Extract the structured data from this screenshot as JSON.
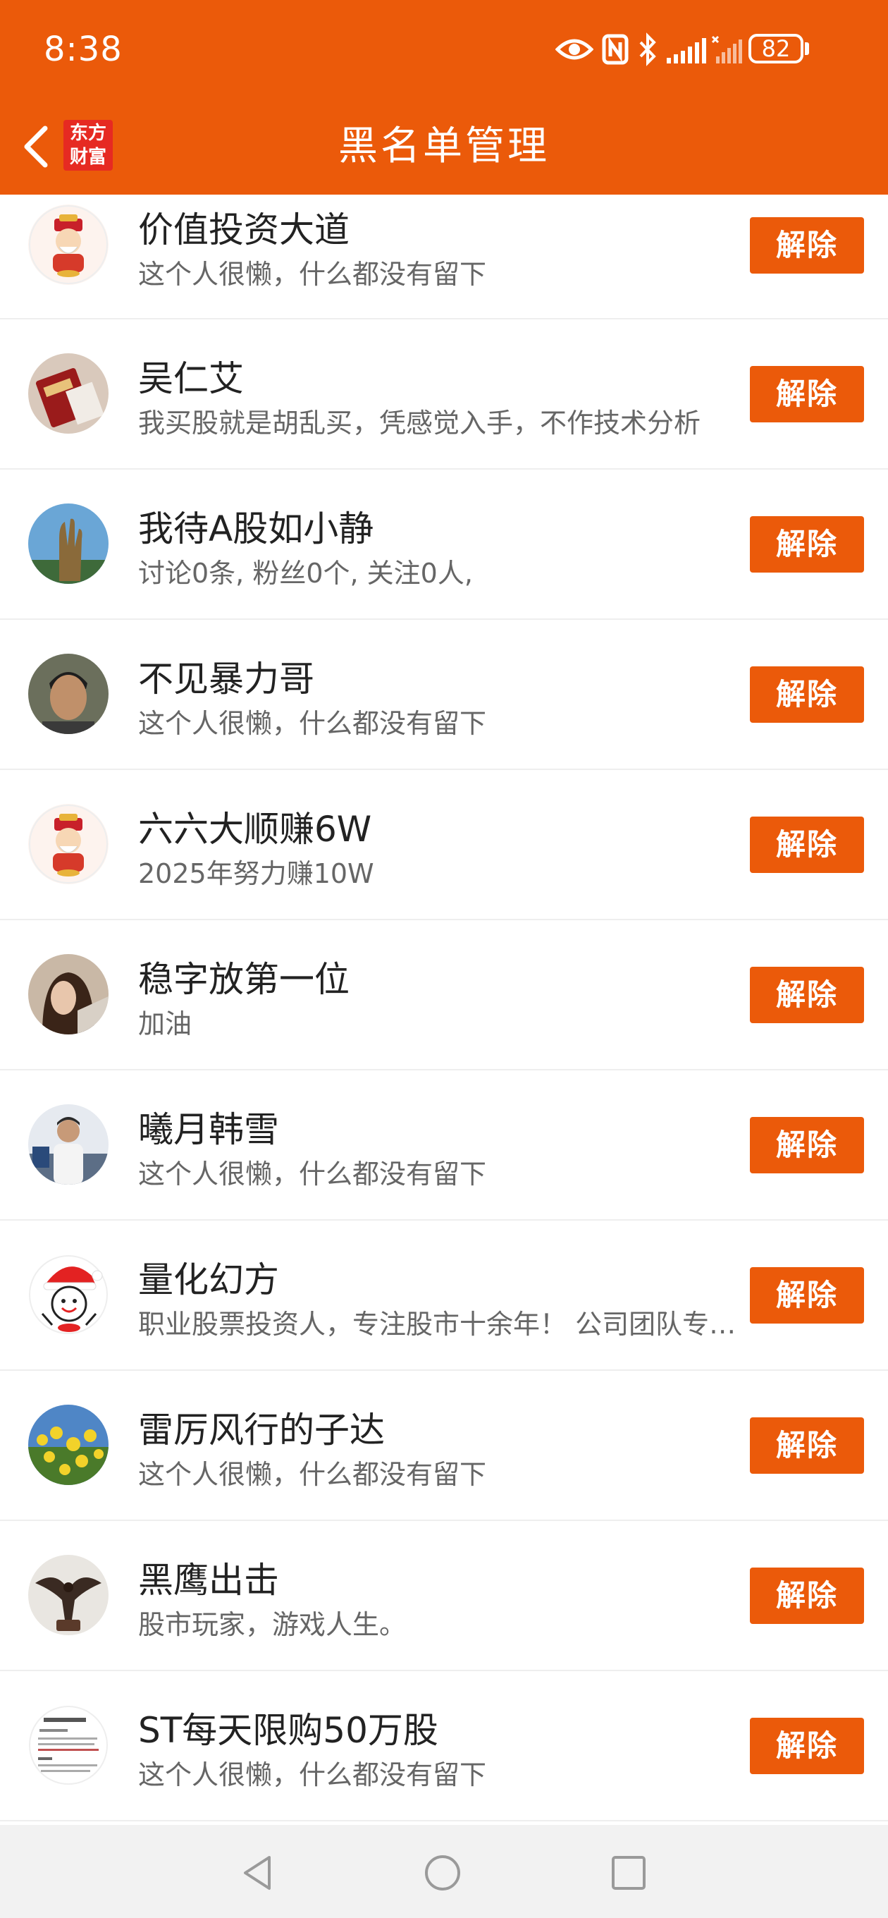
{
  "status_bar": {
    "time": "8:38",
    "battery": "82",
    "icons": [
      "eye-icon",
      "nfc-icon",
      "bluetooth-icon",
      "signal-icon",
      "signal-2-icon",
      "battery-icon"
    ]
  },
  "header": {
    "title": "黑名单管理",
    "logo_line1": "东方",
    "logo_line2": "财富",
    "accent_color": "#eb5a0a"
  },
  "blacklist": [
    {
      "name": "价值投资大道",
      "desc": "这个人很懒，什么都没有留下",
      "action": "解除",
      "avatar": "fortune-god-avatar"
    },
    {
      "name": "吴仁艾",
      "desc": "我买股就是胡乱买，凭感觉入手，不作技术分析",
      "action": "解除",
      "avatar": "cigarette-box-avatar"
    },
    {
      "name": "我待A股如小静",
      "desc": "讨论0条, 粉丝0个, 关注0人,",
      "action": "解除",
      "avatar": "buddha-hand-avatar"
    },
    {
      "name": "不见暴力哥",
      "desc": "这个人很懒，什么都没有留下",
      "action": "解除",
      "avatar": "man-portrait-avatar"
    },
    {
      "name": "六六大顺赚6W",
      "desc": "2025年努力赚10W",
      "action": "解除",
      "avatar": "fortune-god-avatar"
    },
    {
      "name": "稳字放第一位",
      "desc": "加油",
      "action": "解除",
      "avatar": "girl-portrait-avatar"
    },
    {
      "name": "曦月韩雪",
      "desc": "这个人很懒，什么都没有留下",
      "action": "解除",
      "avatar": "man-street-avatar"
    },
    {
      "name": "量化幻方",
      "desc": " 职业股票投资人，专注股市十余年！ 公司团队专业分析",
      "action": "解除",
      "avatar": "santa-cartoon-avatar"
    },
    {
      "name": "雷厉风行的子达",
      "desc": "这个人很懒，什么都没有留下",
      "action": "解除",
      "avatar": "yellow-flowers-avatar"
    },
    {
      "name": "黑鹰出击",
      "desc": "股市玩家，游戏人生。",
      "action": "解除",
      "avatar": "eagle-statue-avatar"
    },
    {
      "name": "ST每天限购50万股",
      "desc": "这个人很懒，什么都没有留下",
      "action": "解除",
      "avatar": "text-document-avatar"
    }
  ],
  "system_nav": {
    "icons": [
      "back-triangle-icon",
      "home-circle-icon",
      "recent-square-icon"
    ]
  }
}
